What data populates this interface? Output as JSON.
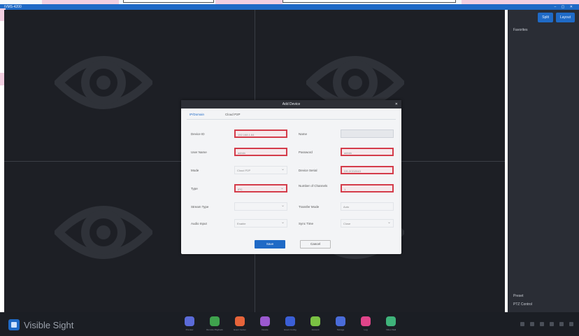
{
  "window": {
    "title": "iVMS-4200",
    "controls": "– ▢ ✕"
  },
  "top_right": {
    "btn1": "Split",
    "btn2": "Layout",
    "section_label": "Favorites"
  },
  "right_bottom": {
    "label1": "Preset",
    "label2": "PTZ Control"
  },
  "brand": {
    "name": "Visible Sight"
  },
  "taskbar_apps": [
    {
      "label": "Preview",
      "color": "#5b6bd8"
    },
    {
      "label": "Remote Playback",
      "color": "#3fa34d"
    },
    {
      "label": "Event Center",
      "color": "#e6643a"
    },
    {
      "label": "Device",
      "color": "#9b59d0"
    },
    {
      "label": "Event Config",
      "color": "#3b5fd6"
    },
    {
      "label": "Account",
      "color": "#7ac143"
    },
    {
      "label": "Storage",
      "color": "#4a6cd9"
    },
    {
      "label": "Log",
      "color": "#e0458a"
    },
    {
      "label": "Video Wall",
      "color": "#3fb37a"
    }
  ],
  "dialog": {
    "title": "Add Device",
    "close": "✕",
    "tabs": [
      "IP/Domain",
      "Cloud P2P"
    ],
    "fields": {
      "device_id_label": "Device ID",
      "device_id_value": "192.168.1.64",
      "name_label": "Name",
      "name_value": "",
      "user_name_label": "User Name",
      "user_name_value": "admin",
      "password_label": "Password",
      "password_value": "admin",
      "mode_label": "Mode",
      "mode_value": "Cloud P2P",
      "device_serial_label": "Device Serial",
      "device_serial_value": "DS-2CD2043",
      "type_label": "Type",
      "type_value": "IPC",
      "channel_no_label": "Number of Channels",
      "channel_no_value": "1",
      "stream_type_label": "Stream Type",
      "stream_type_value": "",
      "transfer_mode_label": "Transfer Mode",
      "transfer_mode_value": "Auto",
      "audio_label": "Audio Input",
      "audio_value": "Enable",
      "time_label": "Sync Time",
      "time_value": "Close"
    },
    "ok": "Save",
    "cancel": "Cancel"
  }
}
